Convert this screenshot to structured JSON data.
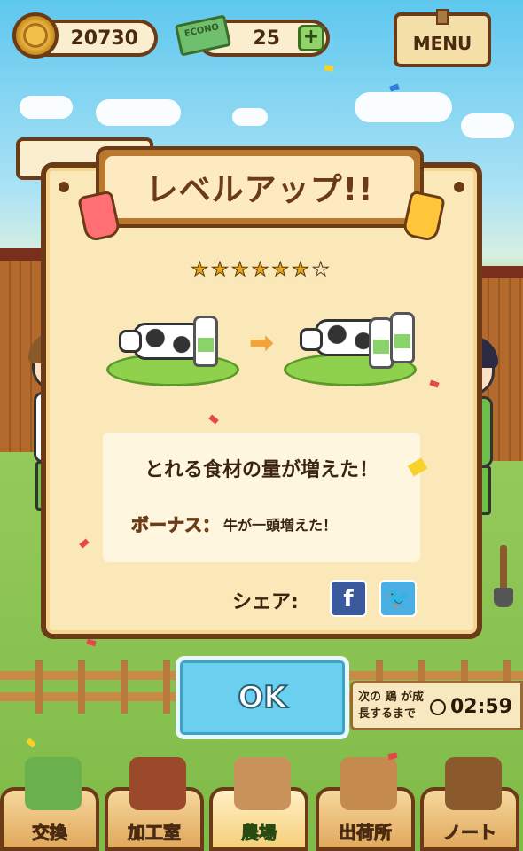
{
  "hud": {
    "coins": "20730",
    "tickets": "25",
    "ticket_brand": "ECONO",
    "plus_label": "+",
    "menu_label": "MENU"
  },
  "dialog": {
    "title": "レベルアップ!!",
    "stars_filled": 6,
    "stars_total": 7,
    "arrow_icon": "arrow-right-icon",
    "message": "とれる食材の量が増えた！",
    "bonus_label": "ボーナス：",
    "bonus_text": "牛が一頭増えた！",
    "share_label": "シェア:",
    "facebook_icon": "f",
    "twitter_icon": "🐦"
  },
  "ok_button": {
    "label": "OK"
  },
  "timer": {
    "label": "次の 鶏 が成長するまで",
    "value": "02:59"
  },
  "tabs": [
    {
      "label": "交換",
      "icon": "vegetables-icon",
      "active": false
    },
    {
      "label": "加工室",
      "icon": "oven-icon",
      "active": false
    },
    {
      "label": "農場",
      "icon": "farm-animals-icon",
      "active": true
    },
    {
      "label": "出荷所",
      "icon": "shipping-box-icon",
      "active": false
    },
    {
      "label": "ノート",
      "icon": "notebook-icon",
      "active": false
    }
  ],
  "colors": {
    "wood_dark": "#6b3b17",
    "panel": "#fbe8b8",
    "ok_blue": "#6bd0ef",
    "grass": "#8fd14d"
  }
}
